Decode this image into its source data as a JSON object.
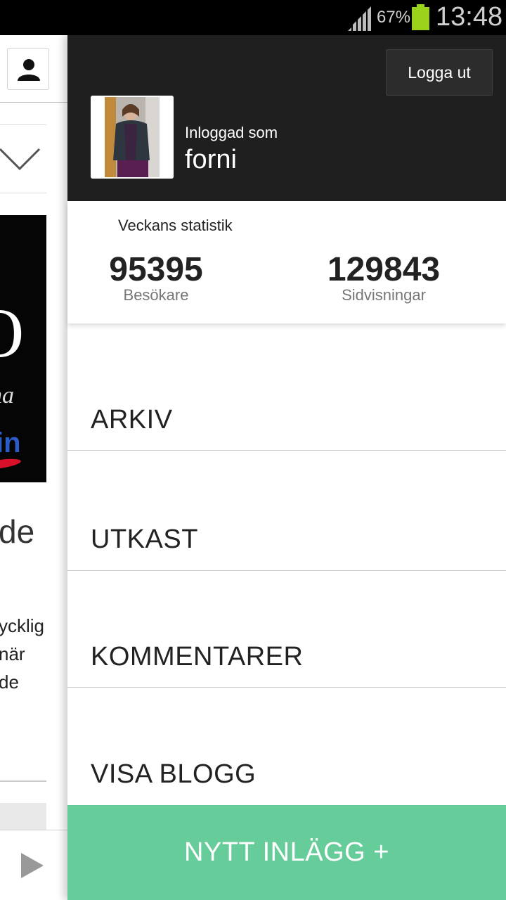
{
  "status_bar": {
    "battery_percent": "67%",
    "time": "13:48",
    "battery_color": "#9bd21c"
  },
  "background_page": {
    "headline_fragment": "de",
    "text_fragment_lines": [
      "ycklig",
      "när",
      "de"
    ],
    "icons": [
      "profile-icon",
      "chevron-down-icon",
      "play-icon"
    ]
  },
  "drawer": {
    "logout_label": "Logga ut",
    "logged_in_as_label": "Inloggad som",
    "username": "forni",
    "stats": {
      "title": "Veckans statistik",
      "visitors_value": "95395",
      "visitors_label": "Besökare",
      "pageviews_value": "129843",
      "pageviews_label": "Sidvisningar"
    },
    "menu": {
      "archive": "ARKIV",
      "drafts": "UTKAST",
      "comments": "KOMMENTARER",
      "view_blog": "VISA BLOGG"
    },
    "new_post_label": "NYTT INLÄGG +",
    "colors": {
      "header_bg": "#1f1f1f",
      "accent_green": "#66cc99"
    }
  }
}
